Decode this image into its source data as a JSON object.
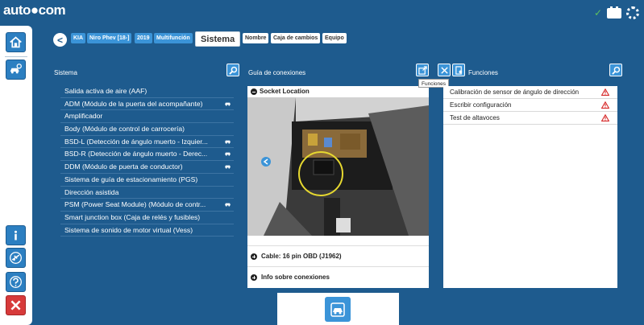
{
  "app": {
    "logo": "auto●com"
  },
  "breadcrumb": {
    "items": [
      "KIA",
      "Niro Phev [18-]",
      "2019",
      "Multifunción"
    ],
    "active": "Sistema",
    "tabs": [
      "Nombre",
      "Caja de cambios",
      "Equipo"
    ]
  },
  "sistema": {
    "title": "Sistema",
    "items": [
      {
        "label": "Salida activa de aire (AAF)",
        "car": false
      },
      {
        "label": "ADM (Módulo de la puerta del acompañante)",
        "car": true
      },
      {
        "label": "Amplificador",
        "car": false
      },
      {
        "label": "Body (Módulo de control de carrocería)",
        "car": false
      },
      {
        "label": "BSD-L (Detección de ángulo muerto - Izquier...",
        "car": true
      },
      {
        "label": "BSD-R (Detección de ángulo muerto - Derec...",
        "car": true
      },
      {
        "label": "DDM (Módulo de puerta de conductor)",
        "car": true
      },
      {
        "label": "Sistema de guía de estacionamiento (PGS)",
        "car": false
      },
      {
        "label": "Dirección asistida",
        "car": false
      },
      {
        "label": "PSM (Power Seat Module) (Módulo de contr...",
        "car": true
      },
      {
        "label": "Smart junction box (Caja de relés y fusibles)",
        "car": false
      },
      {
        "label": "Sistema de sonido de motor virtual (Vess)",
        "car": false
      }
    ]
  },
  "guia": {
    "title": "Guía de conexiones",
    "socket_label": "Socket Location",
    "cable_label": "Cable: 16 pin OBD (J1962)",
    "info_label": "Info sobre conexiones"
  },
  "funciones": {
    "title": "Funciones",
    "tooltip": "Funciones",
    "items": [
      "Calibración de sensor de ángulo de dirección",
      "Escribir configuración",
      "Test de altavoces"
    ]
  },
  "colors": {
    "background": "#1e5b8e",
    "accent": "#3b94d8",
    "warning": "#d62828"
  }
}
